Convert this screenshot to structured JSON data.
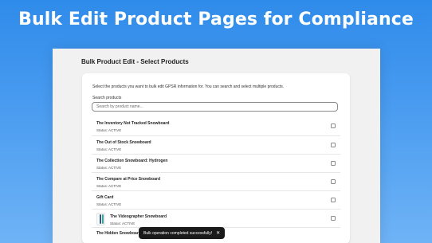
{
  "hero": {
    "title": "Bulk Edit Product Pages for Compliance"
  },
  "page": {
    "heading": "Bulk Product Edit - Select Products"
  },
  "card": {
    "intro": "Select the products you want to bulk edit GPSR information for. You can search and select multiple products.",
    "search_label": "Search products",
    "search_placeholder": "Search by product name...",
    "search_value": ""
  },
  "products": [
    {
      "name": "The Inventory Not Tracked Snowboard",
      "status": "Status: ACTIVE",
      "checked": false
    },
    {
      "name": "The Out of Stock Snowboard",
      "status": "Status: ACTIVE",
      "checked": false
    },
    {
      "name": "The Collection Snowboard: Hydrogen",
      "status": "Status: ACTIVE",
      "checked": false
    },
    {
      "name": "The Compare at Price Snowboard",
      "status": "Status: ACTIVE",
      "checked": false
    },
    {
      "name": "Gift Card",
      "status": "Status: ACTIVE",
      "checked": false
    },
    {
      "name": "The Videographer Snowboard",
      "status": "Status: ACTIVE",
      "checked": false,
      "thumbnail": "snowboard-image"
    },
    {
      "name": "The Hidden Snowboard",
      "status": "",
      "checked": false
    }
  ],
  "toast": {
    "message": "Bulk operation completed successfully!",
    "close_icon": "close-icon"
  },
  "colors": {
    "background": "#3a92ee",
    "card": "#ffffff",
    "frame": "#f1f1f1",
    "toast": "#1a1a1a"
  }
}
